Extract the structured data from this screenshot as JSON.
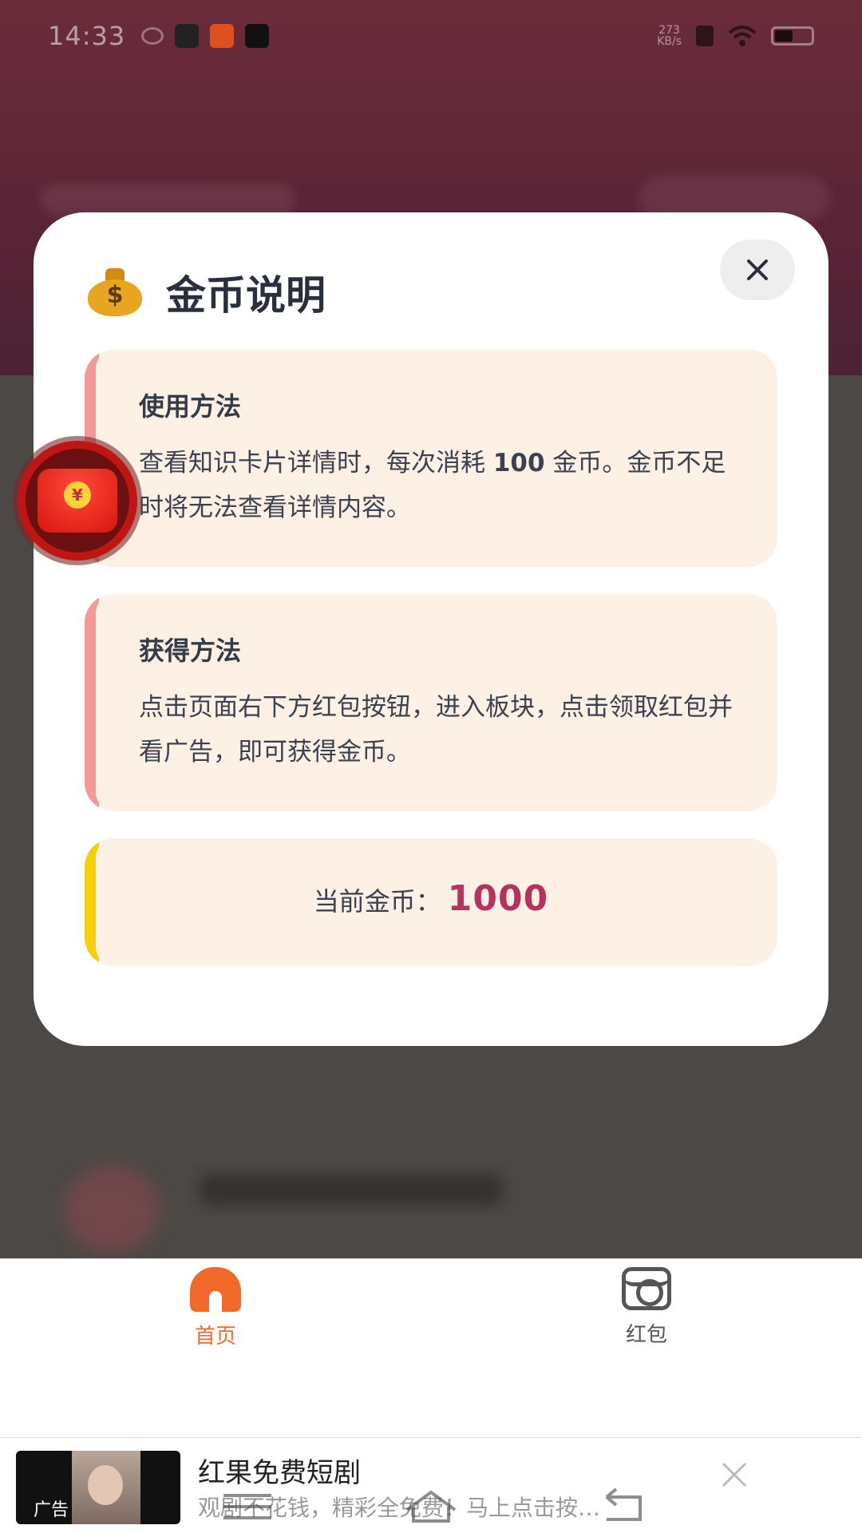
{
  "status_bar": {
    "time": "14:33",
    "net_speed_value": "273",
    "net_speed_unit": "KB/s"
  },
  "modal": {
    "title": "金币说明",
    "icon": "money-bag-icon",
    "usage": {
      "title": "使用方法",
      "body_pre": "查看知识卡片详情时，每次消耗 ",
      "body_amount": "100",
      "body_post": " 金币。金币不足时将无法查看详情内容。"
    },
    "earn": {
      "title": "获得方法",
      "body": "点击页面右下方红包按钮，进入板块，点击领取红包并看广告，即可获得金币。"
    },
    "balance": {
      "label": "当前金币：",
      "value": "1000"
    }
  },
  "bottom_nav": {
    "items": [
      {
        "label": "首页",
        "icon": "home-icon",
        "active": true
      },
      {
        "label": "红包",
        "icon": "red-packet-icon",
        "active": false
      }
    ],
    "active_color": "#f26a2b",
    "inactive_color": "#555555"
  },
  "ad": {
    "tag": "广告",
    "title": "红果免费短剧",
    "description": "观剧不花钱，精彩全免费！马上点击按…"
  },
  "colors": {
    "accent_pink": "#f3999a",
    "accent_yellow": "#f5cf0a",
    "card_bg": "#fdf0e4",
    "coin_value": "#b5335e"
  }
}
